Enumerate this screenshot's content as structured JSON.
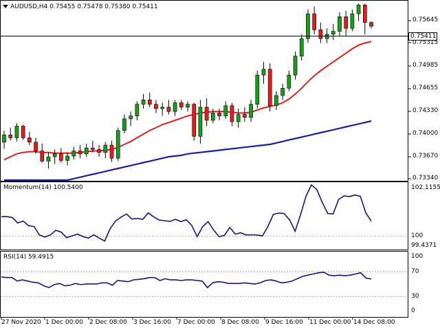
{
  "header": {
    "symbol": "AUDUSD,H4",
    "ohlc": "0.75455 0.75478 0.75380 0.75411"
  },
  "price_axis": [
    "0.75645",
    "0.75315",
    "0.74985",
    "0.74655",
    "0.74330",
    "0.74000",
    "0.73670",
    "0.73340"
  ],
  "current_price_label": "0.75411",
  "momentum": {
    "title": "Momentum(14) 100.5400",
    "axis": [
      "102.1155",
      "100",
      "99.4371"
    ]
  },
  "rsi": {
    "title": "RSI(14) 59.4915",
    "axis": [
      "100",
      "70",
      "30",
      "0"
    ]
  },
  "time_axis": [
    "27 Nov 2020",
    "1 Dec 00:00",
    "2 Dec 08:00",
    "3 Dec 16:00",
    "7 Dec 00:00",
    "8 Dec 08:00",
    "9 Dec 16:00",
    "11 Dec 00:00",
    "14 Dec 08:00"
  ],
  "colors": {
    "bull": "#1a9c1a",
    "bear": "#e02020",
    "sma_fast": "#dc1e1e",
    "sma_slow": "#1c1c9c",
    "indicator": "#14147a"
  },
  "chart_data": {
    "type": "candlestick",
    "symbol": "AUDUSD",
    "timeframe": "H4",
    "ylim": [
      0.733,
      0.7575
    ],
    "candles": [
      [
        0.7382,
        0.7398,
        0.7373,
        0.7392
      ],
      [
        0.7392,
        0.7402,
        0.7384,
        0.7388
      ],
      [
        0.7388,
        0.7408,
        0.7383,
        0.7404
      ],
      [
        0.7404,
        0.7406,
        0.7385,
        0.7388
      ],
      [
        0.7388,
        0.7396,
        0.7378,
        0.7382
      ],
      [
        0.7382,
        0.7388,
        0.7366,
        0.737
      ],
      [
        0.737,
        0.738,
        0.7354,
        0.7356
      ],
      [
        0.7356,
        0.7368,
        0.7346,
        0.7362
      ],
      [
        0.7362,
        0.7372,
        0.7352,
        0.7366
      ],
      [
        0.7366,
        0.7374,
        0.7354,
        0.7357
      ],
      [
        0.7357,
        0.7368,
        0.735,
        0.7363
      ],
      [
        0.7363,
        0.7376,
        0.7358,
        0.737
      ],
      [
        0.737,
        0.7378,
        0.736,
        0.7366
      ],
      [
        0.7366,
        0.738,
        0.7362,
        0.7374
      ],
      [
        0.7374,
        0.7384,
        0.7368,
        0.7372
      ],
      [
        0.7372,
        0.7378,
        0.7362,
        0.7368
      ],
      [
        0.7368,
        0.7382,
        0.736,
        0.7378
      ],
      [
        0.7378,
        0.7384,
        0.7355,
        0.736
      ],
      [
        0.736,
        0.7402,
        0.7356,
        0.7398
      ],
      [
        0.7398,
        0.742,
        0.7394,
        0.7414
      ],
      [
        0.7414,
        0.7424,
        0.7404,
        0.7418
      ],
      [
        0.7418,
        0.7438,
        0.7412,
        0.7434
      ],
      [
        0.7434,
        0.7448,
        0.7428,
        0.744
      ],
      [
        0.744,
        0.745,
        0.743,
        0.7434
      ],
      [
        0.7434,
        0.744,
        0.7422,
        0.7428
      ],
      [
        0.7428,
        0.7436,
        0.7418,
        0.743
      ],
      [
        0.743,
        0.744,
        0.742,
        0.7424
      ],
      [
        0.7424,
        0.744,
        0.7418,
        0.7436
      ],
      [
        0.7436,
        0.744,
        0.7426,
        0.743
      ],
      [
        0.743,
        0.7438,
        0.7424,
        0.7434
      ],
      [
        0.7434,
        0.7436,
        0.7384,
        0.739
      ],
      [
        0.739,
        0.744,
        0.738,
        0.743
      ],
      [
        0.743,
        0.7442,
        0.7404,
        0.7412
      ],
      [
        0.7412,
        0.7428,
        0.7408,
        0.7422
      ],
      [
        0.7422,
        0.7428,
        0.7412,
        0.7418
      ],
      [
        0.7418,
        0.7438,
        0.7414,
        0.7432
      ],
      [
        0.7432,
        0.7436,
        0.7404,
        0.741
      ],
      [
        0.741,
        0.7428,
        0.7402,
        0.742
      ],
      [
        0.742,
        0.743,
        0.741,
        0.7416
      ],
      [
        0.7416,
        0.744,
        0.741,
        0.7434
      ],
      [
        0.7434,
        0.748,
        0.7428,
        0.7474
      ],
      [
        0.7474,
        0.7492,
        0.7462,
        0.7482
      ],
      [
        0.7482,
        0.749,
        0.7424,
        0.7432
      ],
      [
        0.7432,
        0.7452,
        0.7426,
        0.7446
      ],
      [
        0.7446,
        0.7462,
        0.744,
        0.7456
      ],
      [
        0.7456,
        0.748,
        0.7452,
        0.7474
      ],
      [
        0.7474,
        0.7506,
        0.7468,
        0.75
      ],
      [
        0.75,
        0.753,
        0.7494,
        0.7524
      ],
      [
        0.7524,
        0.7564,
        0.7518,
        0.7558
      ],
      [
        0.7558,
        0.7568,
        0.753,
        0.7536
      ],
      [
        0.7536,
        0.7546,
        0.7518,
        0.7524
      ],
      [
        0.7524,
        0.7538,
        0.7518,
        0.753
      ],
      [
        0.753,
        0.7544,
        0.7522,
        0.7534
      ],
      [
        0.7534,
        0.756,
        0.7528,
        0.7554
      ],
      [
        0.7554,
        0.7562,
        0.7528,
        0.7538
      ],
      [
        0.7538,
        0.7564,
        0.7534,
        0.7558
      ],
      [
        0.7558,
        0.7572,
        0.7548,
        0.757
      ],
      [
        0.757,
        0.7572,
        0.753,
        0.7546
      ],
      [
        0.7546,
        0.7548,
        0.7538,
        0.7541
      ]
    ],
    "sma_fast": [
      0.7358,
      0.7362,
      0.7366,
      0.7368,
      0.7369,
      0.7369,
      0.7368,
      0.7368,
      0.7367,
      0.7367,
      0.7367,
      0.7367,
      0.7368,
      0.7369,
      0.737,
      0.737,
      0.7371,
      0.7372,
      0.7375,
      0.7379,
      0.7383,
      0.7388,
      0.7393,
      0.7398,
      0.7402,
      0.7406,
      0.7409,
      0.7412,
      0.7415,
      0.7418,
      0.742,
      0.7422,
      0.7423,
      0.7424,
      0.7424,
      0.7424,
      0.7423,
      0.7422,
      0.7422,
      0.7423,
      0.7426,
      0.7429,
      0.7431,
      0.7433,
      0.7436,
      0.7441,
      0.7448,
      0.7456,
      0.7465,
      0.7473,
      0.748,
      0.7486,
      0.7492,
      0.7498,
      0.7504,
      0.751,
      0.7515,
      0.7518,
      0.752
    ],
    "sma_slow": [
      0.73,
      0.7303,
      0.7306,
      0.7309,
      0.7312,
      0.7315,
      0.7318,
      0.7321,
      0.7324,
      0.7327,
      0.733,
      0.7332,
      0.7334,
      0.7336,
      0.7338,
      0.734,
      0.7342,
      0.7344,
      0.7346,
      0.7348,
      0.735,
      0.7352,
      0.7354,
      0.7356,
      0.7358,
      0.736,
      0.7362,
      0.7363,
      0.7364,
      0.7366,
      0.7367,
      0.7368,
      0.7369,
      0.737,
      0.7371,
      0.7372,
      0.7373,
      0.7374,
      0.7375,
      0.7376,
      0.7377,
      0.7378,
      0.7379,
      0.7381,
      0.7383,
      0.7385,
      0.7387,
      0.7389,
      0.7391,
      0.7393,
      0.7395,
      0.7397,
      0.7399,
      0.7401,
      0.7403,
      0.7405,
      0.7407,
      0.7409,
      0.7411
    ],
    "momentum": {
      "ylim": [
        99.3,
        102.25
      ],
      "values": [
        100.74,
        100.74,
        100.7,
        100.46,
        100.54,
        100.34,
        100.3,
        99.92,
        99.83,
        99.92,
        100.13,
        100.05,
        99.8,
        99.88,
        99.96,
        99.85,
        99.78,
        99.93,
        99.78,
        99.65,
        100.2,
        100.55,
        100.72,
        100.86,
        100.63,
        100.66,
        100.62,
        100.91,
        100.73,
        100.59,
        100.56,
        100.53,
        100.62,
        100.52,
        100.6,
        100.35,
        99.85,
        100.29,
        100.52,
        100.15,
        99.85,
        99.9,
        100.26,
        99.96,
        100.02,
        99.92,
        99.93,
        99.92,
        99.88,
        100.3,
        100.84,
        100.9,
        100.88,
        100.59,
        100.09,
        100.83,
        101.65,
        102.16,
        101.95,
        101.37,
        100.88,
        100.86,
        101.51,
        101.67,
        101.64,
        101.71,
        101.65,
        100.91,
        100.54
      ]
    },
    "rsi": {
      "ylim": [
        0,
        100
      ],
      "levels": [
        70,
        30
      ],
      "values": [
        63,
        62,
        62,
        56,
        58,
        56,
        54,
        53,
        48,
        45,
        50,
        52,
        48,
        49,
        52,
        50,
        51,
        51,
        51,
        53,
        53,
        49,
        57,
        56,
        55,
        58,
        59,
        60,
        62,
        62,
        57,
        60,
        58,
        58,
        57,
        58,
        58,
        57,
        56,
        45,
        53,
        55,
        54,
        52,
        52,
        52,
        53,
        52,
        51,
        53,
        57,
        58,
        56,
        53,
        54,
        56,
        60,
        64,
        66,
        68,
        70,
        71,
        66,
        65,
        66,
        65,
        66,
        68,
        70,
        61,
        59.5
      ]
    }
  }
}
